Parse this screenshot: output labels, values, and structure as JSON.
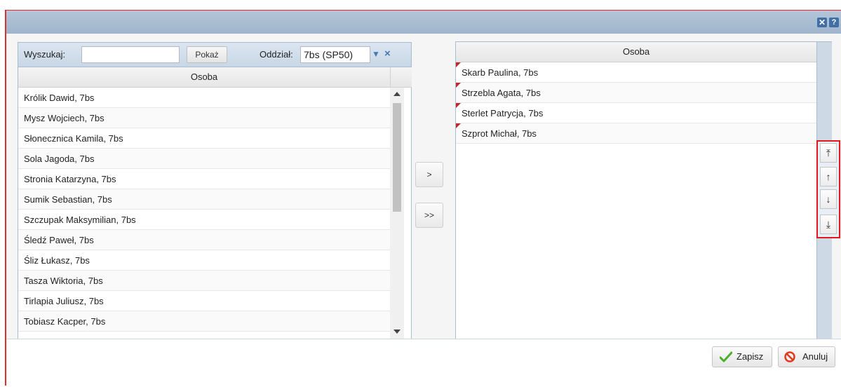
{
  "window": {
    "close_icon": "close-icon",
    "help_label": "?"
  },
  "left_panel": {
    "search_label": "Wyszukaj:",
    "search_value": "",
    "show_button": "Pokaż",
    "class_label": "Oddział:",
    "class_value": "7bs (SP50)",
    "column_header": "Osoba",
    "rows": [
      "Królik Dawid, 7bs",
      "Mysz Wojciech, 7bs",
      "Słonecznica Kamila, 7bs",
      "Sola Jagoda, 7bs",
      "Stronia Katarzyna, 7bs",
      "Sumik Sebastian, 7bs",
      "Szczupak Maksymilian, 7bs",
      "Śledź Paweł, 7bs",
      "Śliz Łukasz, 7bs",
      "Tasza Wiktoria, 7bs",
      "Tirlapia Juliusz, 7bs",
      "Tobiasz Kacper, 7bs"
    ]
  },
  "transfer": {
    "move_one": ">",
    "move_all": ">>"
  },
  "right_panel": {
    "column_header": "Osoba",
    "rows": [
      "Skarb Paulina, 7bs",
      "Strzebla Agata, 7bs",
      "Sterlet Patrycja, 7bs",
      "Szprot Michał, 7bs"
    ]
  },
  "order_buttons": {
    "top": "⤒",
    "up": "↑",
    "down": "↓",
    "bottom": "⤓"
  },
  "footer": {
    "save_label": "Zapisz",
    "cancel_label": "Anuluj"
  }
}
